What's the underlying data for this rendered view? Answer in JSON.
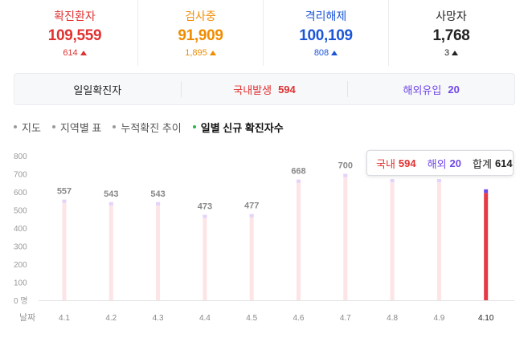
{
  "stats": [
    {
      "label": "확진환자",
      "value": "109,559",
      "change": "614",
      "color": "#e03131"
    },
    {
      "label": "검사중",
      "value": "91,909",
      "change": "1,895",
      "color": "#f08c00"
    },
    {
      "label": "격리해제",
      "value": "100,109",
      "change": "808",
      "color": "#1c56d8"
    },
    {
      "label": "사망자",
      "value": "1,768",
      "change": "3",
      "color": "#222222"
    }
  ],
  "breakdown": {
    "daily_label": "일일확진자",
    "domestic_label": "국내발생",
    "domestic_value": "594",
    "overseas_label": "해외유입",
    "overseas_value": "20",
    "domestic_color": "#e03131",
    "overseas_color": "#7048e8"
  },
  "tabs": [
    {
      "label": "지도",
      "active": false
    },
    {
      "label": "지역별 표",
      "active": false
    },
    {
      "label": "누적확진 추이",
      "active": false
    },
    {
      "label": "일별 신규 확진자수",
      "active": true
    }
  ],
  "tooltip": {
    "domestic_label": "국내",
    "domestic_value": "594",
    "overseas_label": "해외",
    "overseas_value": "20",
    "total_label": "합계",
    "total_value": "614"
  },
  "chart_data": {
    "type": "bar",
    "categories": [
      "4.1",
      "4.2",
      "4.3",
      "4.4",
      "4.5",
      "4.6",
      "4.7",
      "4.8",
      "4.9",
      "4.10"
    ],
    "values": [
      557,
      543,
      543,
      473,
      477,
      668,
      700,
      671,
      671,
      614
    ],
    "data_labels": [
      "557",
      "543",
      "543",
      "473",
      "477",
      "668",
      "700",
      "",
      "",
      ""
    ],
    "domestic_last": 594,
    "overseas_last": 20,
    "selected_index": 9,
    "y_ticks": [
      "800",
      "700",
      "600",
      "500",
      "400",
      "300",
      "200",
      "100",
      "0 명"
    ],
    "y_tick_values": [
      800,
      700,
      600,
      500,
      400,
      300,
      200,
      100,
      0
    ],
    "xlabel": "날짜",
    "ylim": [
      0,
      800
    ],
    "colors": {
      "bar": "#fde4e7",
      "bar_top": "#e3d3fb",
      "selected": "#e63946",
      "selected_top": "#7048e8",
      "label": "#888888"
    }
  }
}
